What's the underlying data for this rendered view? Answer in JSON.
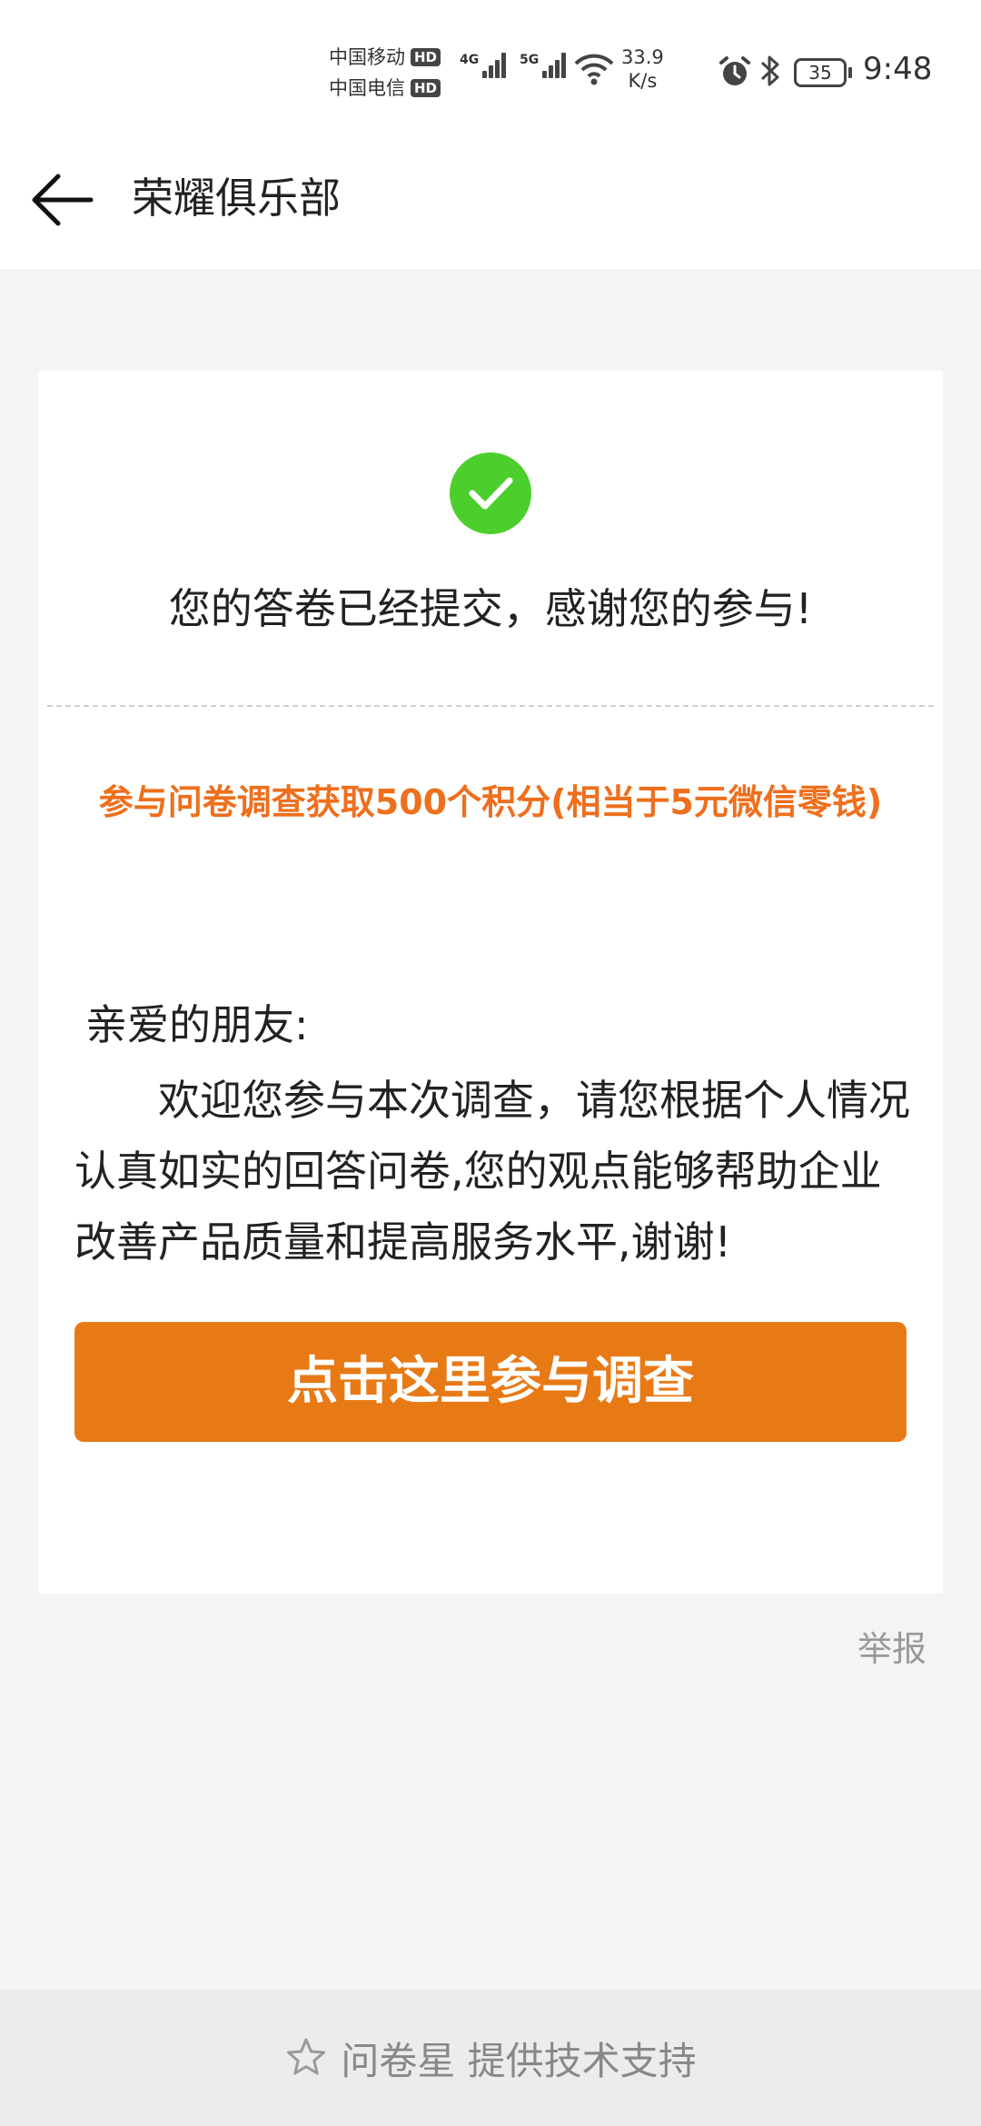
{
  "status_bar": {
    "carrier_1": "中国移动",
    "carrier_2": "中国电信",
    "hd_badge": "HD",
    "net_1": "4G",
    "net_2": "5G",
    "speed_value": "33.9",
    "speed_unit": "K/s",
    "battery": "35",
    "time": "9:48"
  },
  "header": {
    "title": "荣耀俱乐部",
    "back_icon": "arrow-left-icon"
  },
  "card": {
    "success_icon": "check-circle-icon",
    "success_message": "您的答卷已经提交，感谢您的参与!",
    "reward_text": "参与问卷调查获取500个积分(相当于5元微信零钱)",
    "greeting": "亲爱的朋友:",
    "intro": "欢迎您参与本次调查，请您根据个人情况认真如实的回答问卷,您的观点能够帮助企业改善产品质量和提高服务水平,谢谢!",
    "cta_label": "点击这里参与调查"
  },
  "report_label": "举报",
  "footer": {
    "star_icon": "star-outline-icon",
    "text": "问卷星 提供技术支持"
  },
  "colors": {
    "accent": "#e87a16",
    "reward": "#ee6f1d",
    "success": "#4ccf2c"
  }
}
